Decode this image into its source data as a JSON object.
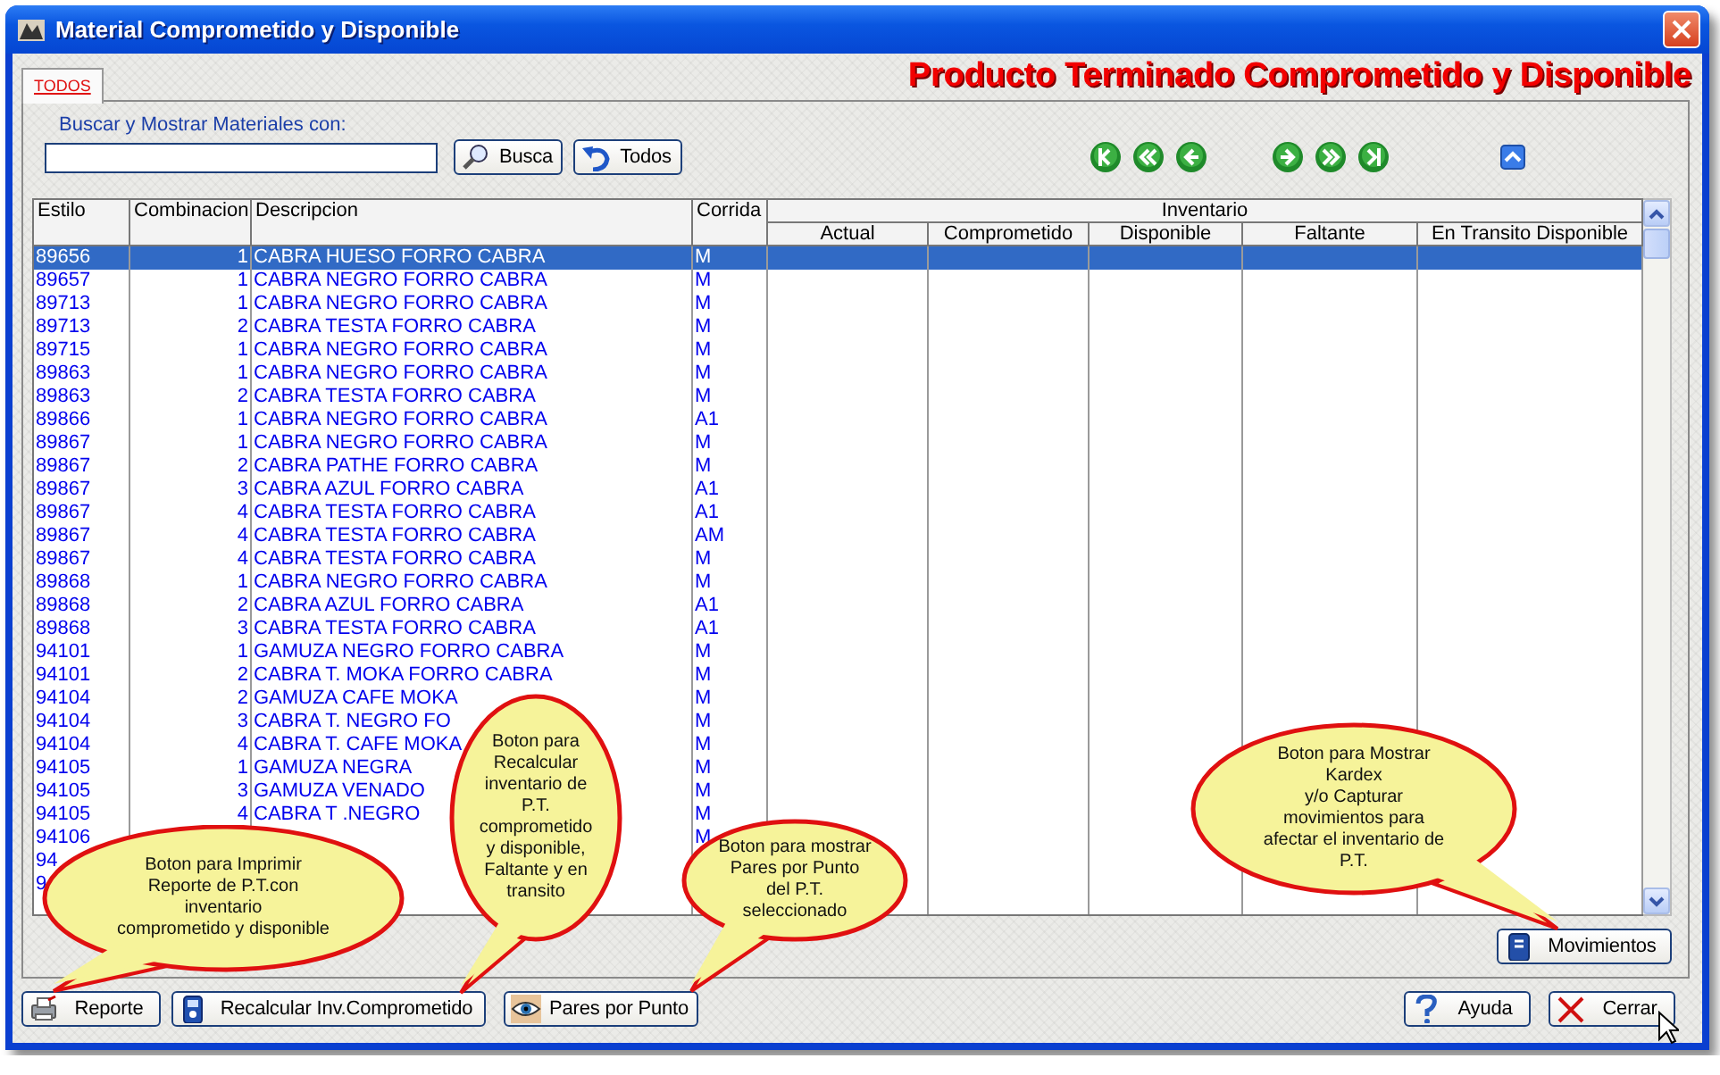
{
  "window": {
    "title": "Material Comprometido y Disponible"
  },
  "tabs": [
    {
      "label": "TODOS",
      "selected": true
    }
  ],
  "heading": "Producto Terminado Comprometido y Disponible",
  "search": {
    "label": "Buscar y Mostrar Materiales con:"
  },
  "search_buttons": [
    {
      "label": "Busca",
      "kind": "search"
    },
    {
      "label": "Todos",
      "kind": "undo"
    }
  ],
  "table": {
    "columns": [
      "Estilo",
      "Combinacion",
      "Descripcion",
      "Corrida"
    ],
    "group": "Inventario",
    "subcolumns": [
      "Actual",
      "Comprometido",
      "Disponible",
      "Faltante",
      "En Transito Disponible"
    ],
    "rows": [
      {
        "estilo": "89656",
        "combinacion": "1",
        "descripcion": "CABRA HUESO FORRO CABRA",
        "corrida": "M",
        "selected": true
      },
      {
        "estilo": "89657",
        "combinacion": "1",
        "descripcion": "CABRA NEGRO FORRO CABRA",
        "corrida": "M",
        "selected": false
      },
      {
        "estilo": "89713",
        "combinacion": "1",
        "descripcion": "CABRA NEGRO FORRO CABRA",
        "corrida": "M",
        "selected": false
      },
      {
        "estilo": "89713",
        "combinacion": "2",
        "descripcion": "CABRA TESTA FORRO CABRA",
        "corrida": "M",
        "selected": false
      },
      {
        "estilo": "89715",
        "combinacion": "1",
        "descripcion": "CABRA NEGRO FORRO CABRA",
        "corrida": "M",
        "selected": false
      },
      {
        "estilo": "89863",
        "combinacion": "1",
        "descripcion": "CABRA NEGRO FORRO CABRA",
        "corrida": "M",
        "selected": false
      },
      {
        "estilo": "89863",
        "combinacion": "2",
        "descripcion": "CABRA TESTA FORRO CABRA",
        "corrida": "M",
        "selected": false
      },
      {
        "estilo": "89866",
        "combinacion": "1",
        "descripcion": "CABRA NEGRO FORRO CABRA",
        "corrida": "A1",
        "selected": false
      },
      {
        "estilo": "89867",
        "combinacion": "1",
        "descripcion": "CABRA NEGRO FORRO CABRA",
        "corrida": "M",
        "selected": false
      },
      {
        "estilo": "89867",
        "combinacion": "2",
        "descripcion": "CABRA PATHE FORRO CABRA",
        "corrida": "M",
        "selected": false
      },
      {
        "estilo": "89867",
        "combinacion": "3",
        "descripcion": "CABRA AZUL FORRO CABRA",
        "corrida": "A1",
        "selected": false
      },
      {
        "estilo": "89867",
        "combinacion": "4",
        "descripcion": "CABRA TESTA FORRO CABRA",
        "corrida": "A1",
        "selected": false
      },
      {
        "estilo": "89867",
        "combinacion": "4",
        "descripcion": "CABRA TESTA FORRO CABRA",
        "corrida": "AM",
        "selected": false
      },
      {
        "estilo": "89867",
        "combinacion": "4",
        "descripcion": "CABRA TESTA FORRO CABRA",
        "corrida": "M",
        "selected": false
      },
      {
        "estilo": "89868",
        "combinacion": "1",
        "descripcion": "CABRA NEGRO FORRO CABRA",
        "corrida": "M",
        "selected": false
      },
      {
        "estilo": "89868",
        "combinacion": "2",
        "descripcion": "CABRA AZUL FORRO CABRA",
        "corrida": "A1",
        "selected": false
      },
      {
        "estilo": "89868",
        "combinacion": "3",
        "descripcion": "CABRA TESTA FORRO CABRA",
        "corrida": "A1",
        "selected": false
      },
      {
        "estilo": "94101",
        "combinacion": "1",
        "descripcion": "GAMUZA NEGRO FORRO CABRA",
        "corrida": "M",
        "selected": false
      },
      {
        "estilo": "94101",
        "combinacion": "2",
        "descripcion": "CABRA T. MOKA FORRO CABRA",
        "corrida": "M",
        "selected": false
      },
      {
        "estilo": "94104",
        "combinacion": "2",
        "descripcion": "GAMUZA CAFE MOKA",
        "corrida": "M",
        "selected": false
      },
      {
        "estilo": "94104",
        "combinacion": "3",
        "descripcion": "CABRA T. NEGRO FO",
        "corrida": "M",
        "selected": false
      },
      {
        "estilo": "94104",
        "combinacion": "4",
        "descripcion": "CABRA T. CAFE MOKA",
        "corrida": "M",
        "selected": false
      },
      {
        "estilo": "94105",
        "combinacion": "1",
        "descripcion": "GAMUZA NEGRA",
        "corrida": "M",
        "selected": false
      },
      {
        "estilo": "94105",
        "combinacion": "3",
        "descripcion": "GAMUZA VENADO",
        "corrida": "M",
        "selected": false
      },
      {
        "estilo": "94105",
        "combinacion": "4",
        "descripcion": "CABRA T .NEGRO",
        "corrida": "M",
        "selected": false
      },
      {
        "estilo": "94106",
        "corrida": "M",
        "selected": false
      },
      {
        "estilo": "94",
        "selected": false
      },
      {
        "estilo": "9",
        "selected": false
      }
    ]
  },
  "panel_button": {
    "label": "Movimientos",
    "kind": "book"
  },
  "buttons": [
    {
      "label": "Reporte",
      "kind": "printer"
    },
    {
      "label": "Recalcular Inv.Comprometido",
      "kind": "device"
    },
    {
      "label": "Pares por Punto",
      "kind": "eye"
    },
    {
      "label": "Ayuda",
      "kind": "help"
    },
    {
      "label": "Cerrar",
      "kind": "close"
    }
  ],
  "callouts": [
    {
      "text": "Boton para Imprimir\nReporte de P.T.con\ninventario\ncomprometido y disponible"
    },
    {
      "text": "Boton para\nRecalcular\ninventario de\nP.T.\ncomprometido\ny disponible,\nFaltante y en\ntransito"
    },
    {
      "text": "Boton para mostrar\nPares por Punto\ndel P.T.\nseleccionado"
    },
    {
      "text": "Boton para Mostrar\nKardex\ny/o Capturar\nmovimientos para\nafectar el inventario de\nP.T."
    }
  ]
}
